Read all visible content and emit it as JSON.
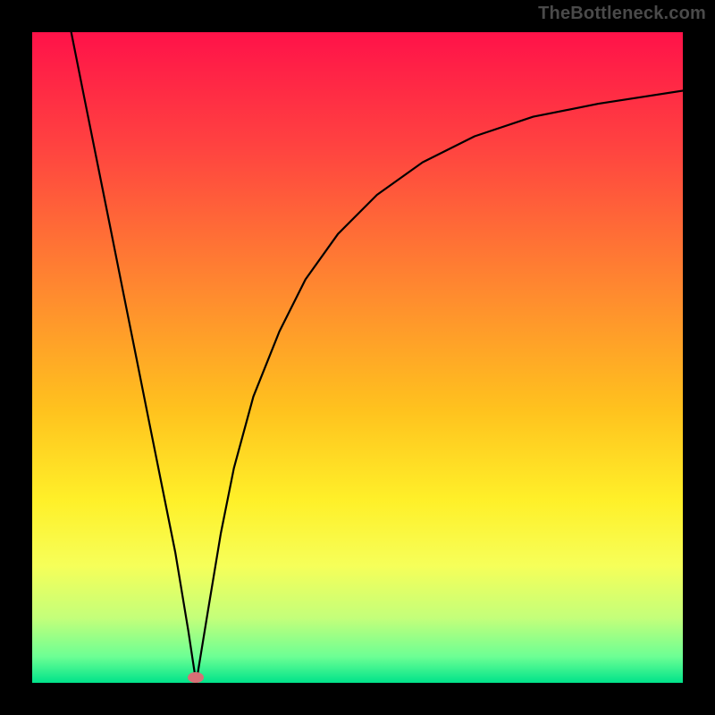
{
  "watermark": "TheBottleneck.com",
  "marker": {
    "x_fraction": 0.252,
    "y_fraction": 0.992
  },
  "gradient": {
    "stops": [
      {
        "offset": 0.0,
        "color": "#ff1249"
      },
      {
        "offset": 0.18,
        "color": "#ff4440"
      },
      {
        "offset": 0.4,
        "color": "#ff8a2f"
      },
      {
        "offset": 0.58,
        "color": "#ffc21e"
      },
      {
        "offset": 0.72,
        "color": "#fff029"
      },
      {
        "offset": 0.82,
        "color": "#f6ff59"
      },
      {
        "offset": 0.9,
        "color": "#c4ff7a"
      },
      {
        "offset": 0.96,
        "color": "#6cff94"
      },
      {
        "offset": 1.0,
        "color": "#00e38a"
      }
    ]
  },
  "chart_data": {
    "type": "line",
    "title": "",
    "xlabel": "",
    "ylabel": "",
    "xlim": [
      0,
      1
    ],
    "ylim": [
      0,
      1
    ],
    "series": [
      {
        "name": "left-branch",
        "x": [
          0.06,
          0.08,
          0.1,
          0.12,
          0.14,
          0.16,
          0.18,
          0.2,
          0.22,
          0.24,
          0.252
        ],
        "y": [
          1.0,
          0.9,
          0.8,
          0.7,
          0.6,
          0.5,
          0.4,
          0.3,
          0.2,
          0.08,
          0.0
        ]
      },
      {
        "name": "right-branch",
        "x": [
          0.252,
          0.27,
          0.29,
          0.31,
          0.34,
          0.38,
          0.42,
          0.47,
          0.53,
          0.6,
          0.68,
          0.77,
          0.87,
          1.0
        ],
        "y": [
          0.0,
          0.11,
          0.23,
          0.33,
          0.44,
          0.54,
          0.62,
          0.69,
          0.75,
          0.8,
          0.84,
          0.87,
          0.89,
          0.91
        ]
      }
    ],
    "marker_point": {
      "x": 0.252,
      "y": 0.0
    }
  }
}
